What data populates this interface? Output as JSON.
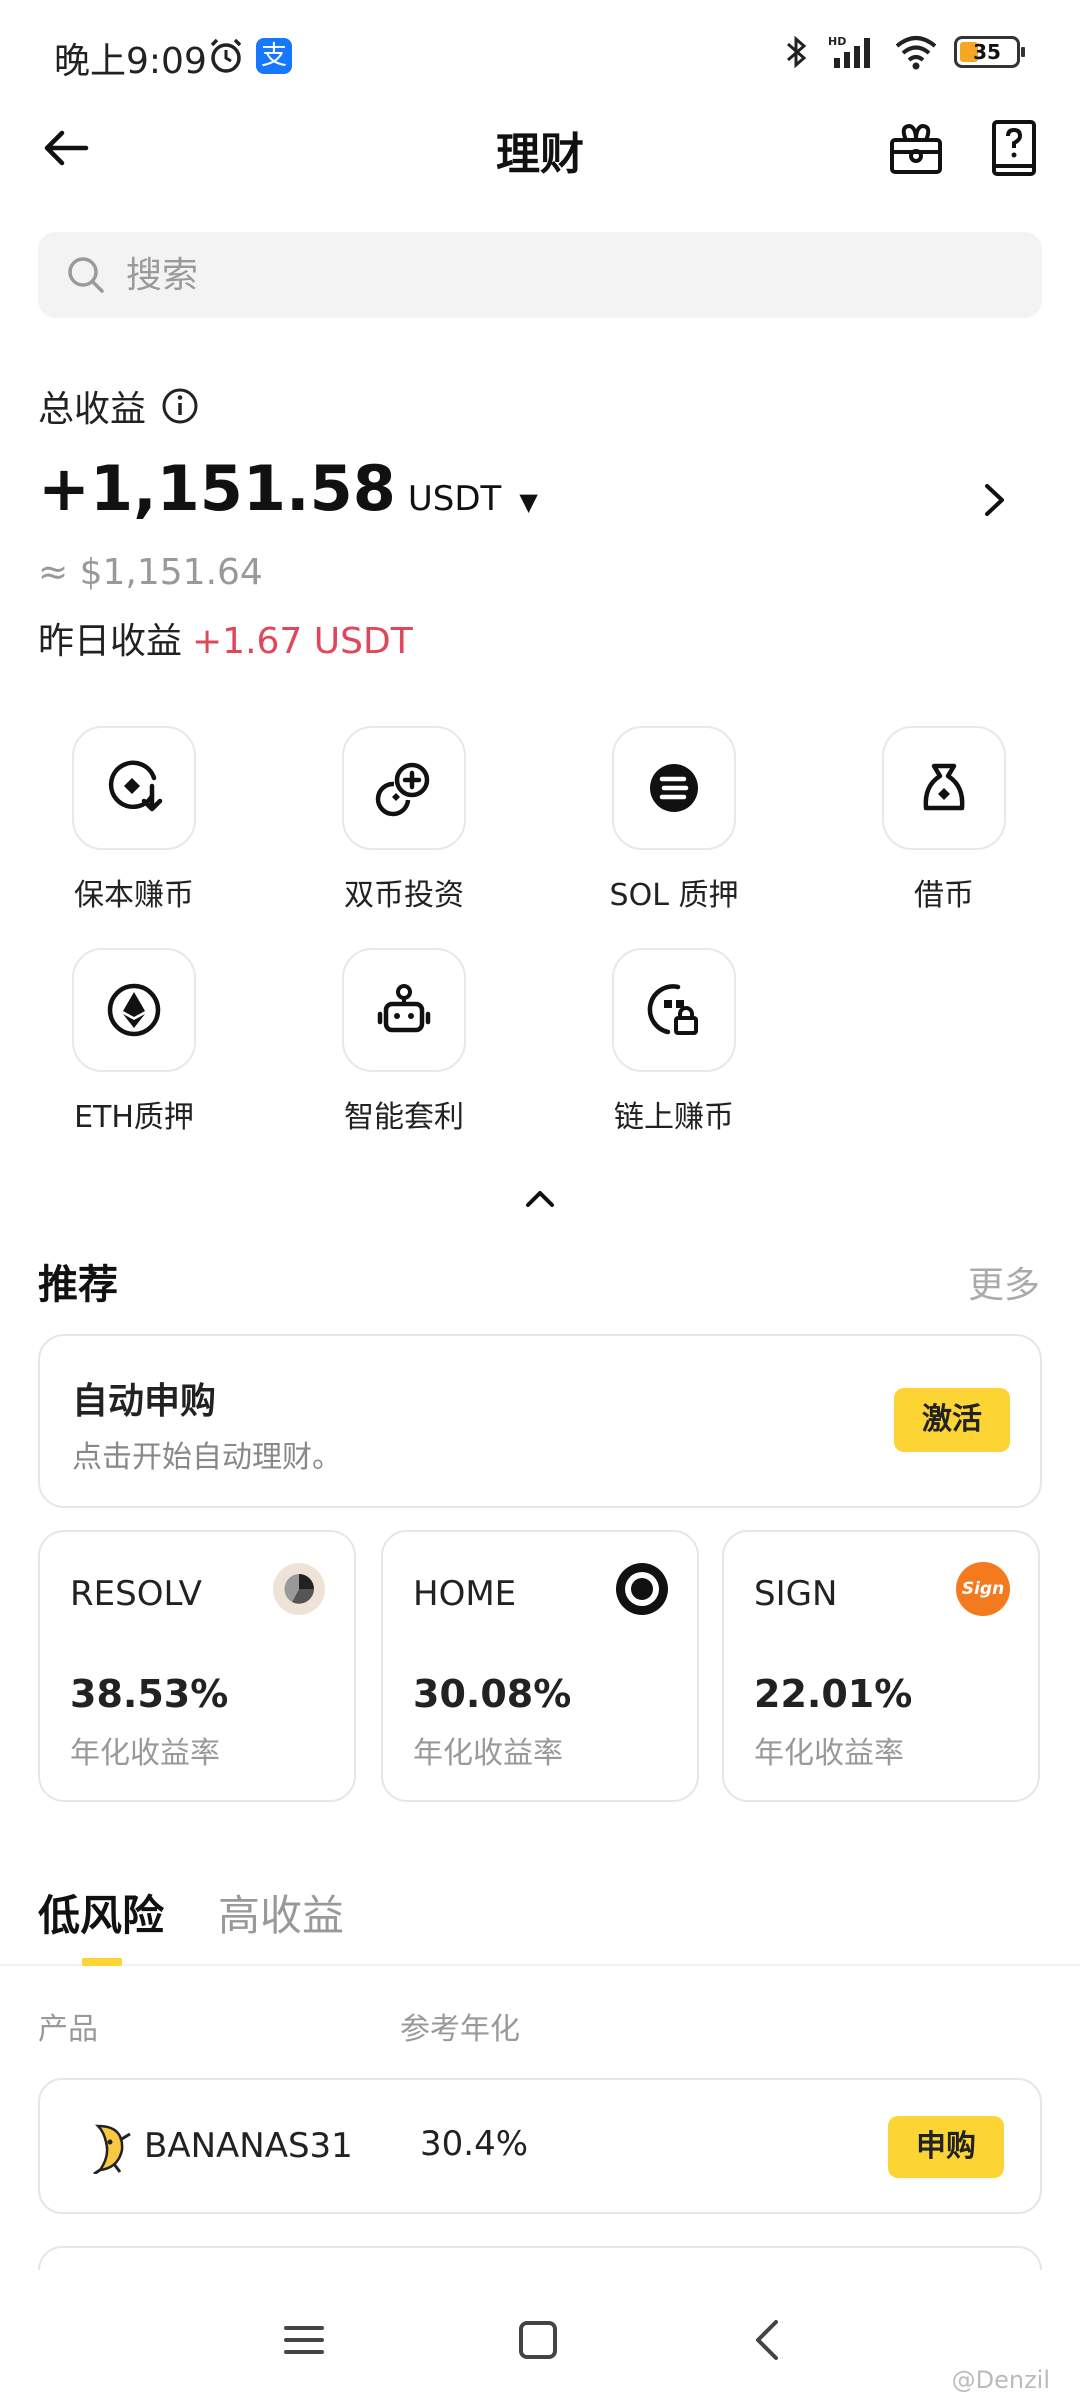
{
  "status_bar": {
    "time": "晚上9:09",
    "alipay_glyph": "支",
    "battery": "35"
  },
  "header": {
    "title": "理财"
  },
  "search": {
    "placeholder": "搜索"
  },
  "earnings": {
    "total_label": "总收益",
    "total_value": "+1,151.58",
    "unit": "USDT",
    "usd_value": "≈ $1,151.64",
    "yesterday_label": "昨日收益",
    "yesterday_value": "+1.67 USDT",
    "yesterday_color": "#e0475a"
  },
  "grid": [
    {
      "label": "保本赚币",
      "icon": "coin-down-icon"
    },
    {
      "label": "双币投资",
      "icon": "dual-coin-icon"
    },
    {
      "label": "SOL 质押",
      "icon": "sol-icon"
    },
    {
      "label": "借币",
      "icon": "loan-bag-icon"
    },
    {
      "label": "ETH质押",
      "icon": "eth-icon"
    },
    {
      "label": "智能套利",
      "icon": "robot-icon"
    },
    {
      "label": "链上赚币",
      "icon": "onchain-icon"
    }
  ],
  "recommend": {
    "title": "推荐",
    "more": "更多",
    "auto": {
      "title": "自动申购",
      "subtitle": "点击开始自动理财。",
      "button": "激活"
    },
    "coins": [
      {
        "name": "RESOLV",
        "rate": "38.53%",
        "sub": "年化收益率"
      },
      {
        "name": "HOME",
        "rate": "30.08%",
        "sub": "年化收益率"
      },
      {
        "name": "SIGN",
        "rate": "22.01%",
        "sub": "年化收益率",
        "icon_text": "Sign"
      }
    ]
  },
  "tabs": {
    "low": "低风险",
    "high": "高收益"
  },
  "table": {
    "col_product": "产品",
    "col_apy": "参考年化",
    "rows": [
      {
        "name": "BANANAS31",
        "apy": "30.4%",
        "button": "申购"
      }
    ]
  },
  "watermark": "@Denzil",
  "accent": "#fcd535"
}
